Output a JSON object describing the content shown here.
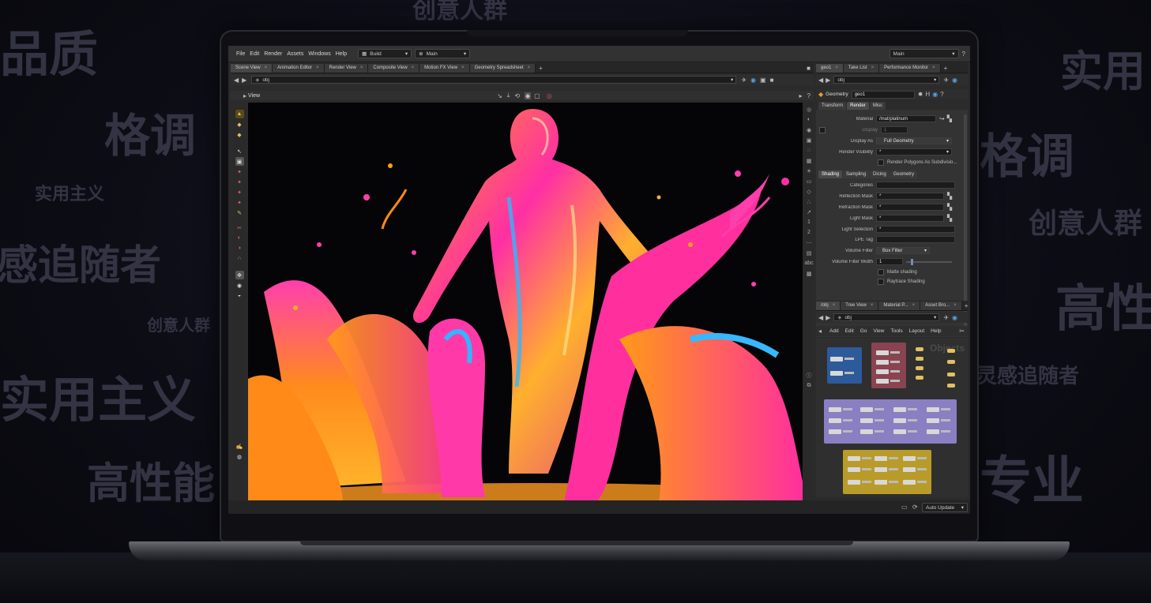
{
  "background_words": [
    "品质",
    "格调",
    "实用主义",
    "感追随者",
    "创意人群",
    "实用主义",
    "高性能",
    "创意人群",
    "实用",
    "格调",
    "创意人群",
    "高性",
    "灵感追随者",
    "专业"
  ],
  "menu": {
    "items": [
      "File",
      "Edit",
      "Render",
      "Assets",
      "Windows",
      "Help"
    ],
    "desktop": "Build",
    "context": "Main",
    "right_desktop": "Main"
  },
  "left_tabs": [
    "Scene View",
    "Animation Editor",
    "Render View",
    "Composite View",
    "Motion FX View",
    "Geometry Spreadsheet"
  ],
  "right_tabs": [
    "geo1",
    "Take List",
    "Performance Monitor"
  ],
  "left_path": "obj",
  "right_path": "obj",
  "viewport": {
    "label": "View"
  },
  "params": {
    "type": "Geometry",
    "name": "geo1",
    "tabs": [
      "Transform",
      "Render",
      "Misc"
    ],
    "active_tab": "Render",
    "material_label": "Material",
    "material_value": "/mat/platinum",
    "display_label": "Display",
    "display_value": "1",
    "display_as_label": "Display As",
    "display_as_value": "Full Geometry",
    "render_visibility_label": "Render Visibility",
    "render_visibility_value": "*",
    "render_polygons_label": "Render Polygons As Subdivisio...",
    "sub_tabs": [
      "Shading",
      "Sampling",
      "Dicing",
      "Geometry"
    ],
    "categories_label": "Categories",
    "reflection_mask_label": "Reflection Mask",
    "reflection_mask_value": "*",
    "refraction_mask_label": "Refraction Mask",
    "refraction_mask_value": "*",
    "light_mask_label": "Light Mask",
    "light_mask_value": "*",
    "light_selection_label": "Light Selection",
    "light_selection_value": "*",
    "lpe_tag_label": "LPE Tag",
    "volume_filter_label": "Volume Filter",
    "volume_filter_value": "Box Filter",
    "volume_filter_width_label": "Volume Filter Width",
    "volume_filter_width_value": "1",
    "matte_shading_label": "Matte shading",
    "raytrace_shading_label": "Raytrace Shading"
  },
  "network": {
    "tabs": [
      "/obj",
      "Tree View",
      "Material P...",
      "Asset Bro..."
    ],
    "path": "obj",
    "menu": [
      "Add",
      "Edit",
      "Go",
      "View",
      "Tools",
      "Layout",
      "Help"
    ],
    "watermark": "Objects"
  },
  "status": {
    "auto_update": "Auto Update"
  },
  "colors": {
    "accent_yellow": "#e0c060",
    "net_blue": "#2d5a9a",
    "net_red": "#8a4350",
    "net_purple": "#8a7fc2",
    "net_gold": "#b99b2a"
  }
}
